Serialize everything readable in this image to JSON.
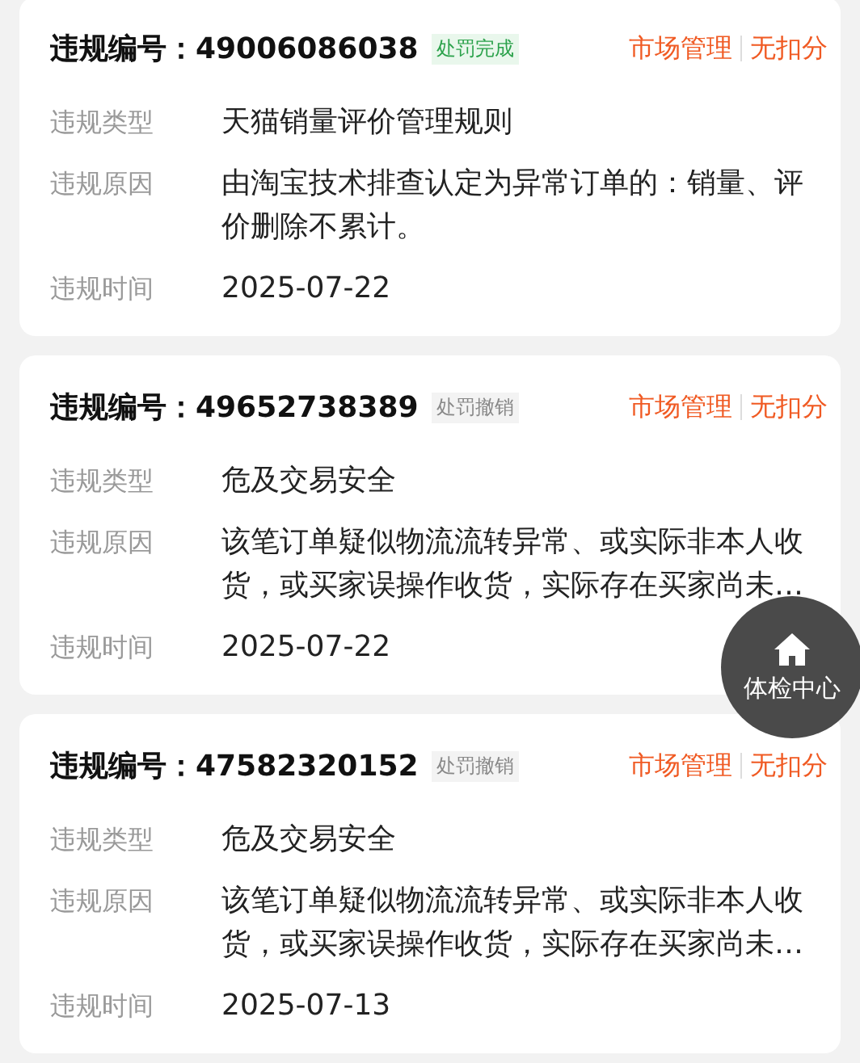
{
  "records": [
    {
      "number_label": "违规编号：",
      "number": "49006086038",
      "status": {
        "text": "处罚完成",
        "kind": "done"
      },
      "category": "市场管理",
      "deduction": "无扣分",
      "fields": [
        {
          "label": "违规类型",
          "value": "天猫销量评价管理规则"
        },
        {
          "label": "违规原因",
          "value": "由淘宝技术排查认定为异常订单的：销量、评价删除不累计。"
        },
        {
          "label": "违规时间",
          "value": "2025-07-22"
        }
      ]
    },
    {
      "number_label": "违规编号：",
      "number": "49652738389",
      "status": {
        "text": "处罚撤销",
        "kind": "revoked"
      },
      "category": "市场管理",
      "deduction": "无扣分",
      "fields": [
        {
          "label": "违规类型",
          "value": "危及交易安全"
        },
        {
          "label": "违规原因",
          "value": "该笔订单疑似物流流转异常、或实际非本人收货，或买家误操作收货，实际存在买家尚未…"
        },
        {
          "label": "违规时间",
          "value": "2025-07-22"
        }
      ]
    },
    {
      "number_label": "违规编号：",
      "number": "47582320152",
      "status": {
        "text": "处罚撤销",
        "kind": "revoked"
      },
      "category": "市场管理",
      "deduction": "无扣分",
      "fields": [
        {
          "label": "违规类型",
          "value": "危及交易安全"
        },
        {
          "label": "违规原因",
          "value": "该笔订单疑似物流流转异常、或实际非本人收货，或买家误操作收货，实际存在买家尚未…"
        },
        {
          "label": "违规时间",
          "value": "2025-07-13"
        }
      ]
    }
  ],
  "float_button": {
    "label": "体检中心"
  }
}
